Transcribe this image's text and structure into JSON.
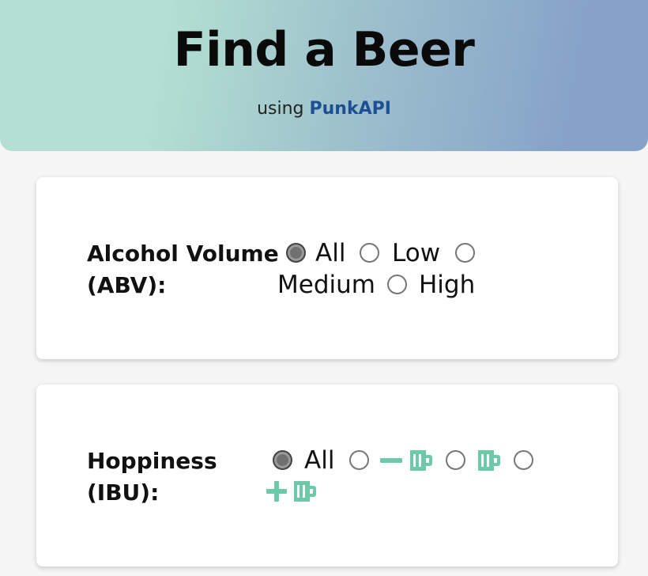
{
  "header": {
    "title": "Find a Beer",
    "subtitle_prefix": "using",
    "subtitle_link": "PunkAPI"
  },
  "abv_filter": {
    "label_line1": "Alcohol Volume",
    "label_line2": "(ABV):",
    "options": [
      {
        "label": "All",
        "checked": true
      },
      {
        "label": "Low",
        "checked": false
      },
      {
        "label": "Medium",
        "checked": false
      },
      {
        "label": "High",
        "checked": false
      }
    ]
  },
  "ibu_filter": {
    "label_line1": "Hoppiness",
    "label_line2": "(IBU):",
    "options": [
      {
        "label": "All",
        "checked": true
      },
      {
        "label": "",
        "icon": "minus-beer-mug-icon",
        "checked": false
      },
      {
        "label": "",
        "icon": "beer-mug-icon",
        "checked": false
      },
      {
        "label": "",
        "icon": "plus-beer-mug-icon",
        "checked": false
      }
    ]
  },
  "colors": {
    "icon_teal": "#6ccaa9",
    "link_blue": "#1d4f95",
    "radio_checked": "#707070"
  }
}
